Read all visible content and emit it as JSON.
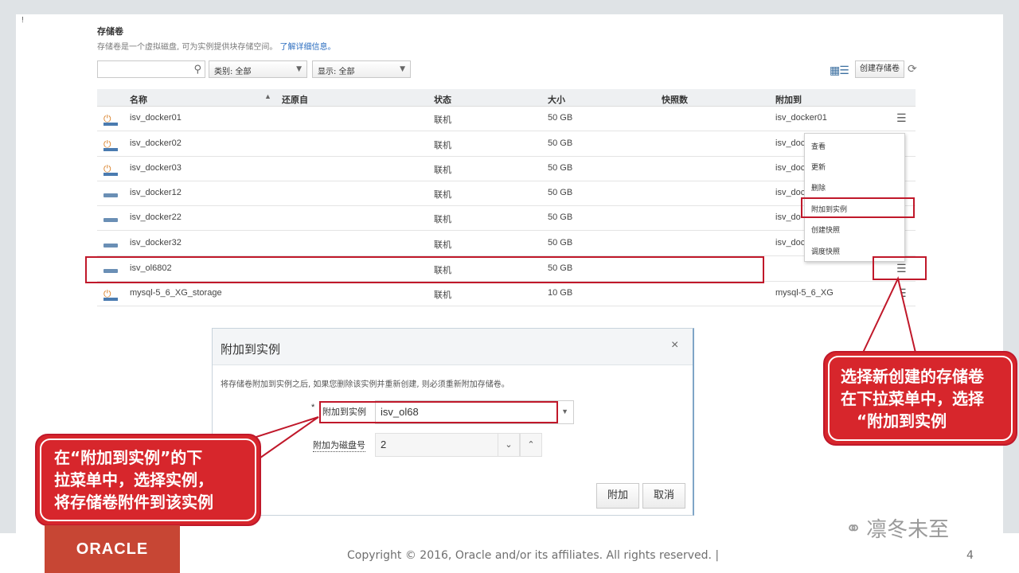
{
  "header": {
    "title": "存储卷",
    "description": "存储卷是一个虚拟磁盘, 可为实例提供块存储空间。",
    "learn_more": "了解详细信息。"
  },
  "toolbar": {
    "search_placeholder": "",
    "category_filter": "类别: 全部",
    "display_filter": "显示: 全部",
    "create_button": "创建存储卷"
  },
  "table": {
    "columns": [
      "名称",
      "还原自",
      "状态",
      "大小",
      "快照数",
      "附加到"
    ],
    "rows": [
      {
        "icon": "power",
        "name": "isv_docker01",
        "restore": "",
        "status": "联机",
        "size": "50 GB",
        "snapshots": "",
        "attached": "isv_docker01"
      },
      {
        "icon": "power",
        "name": "isv_docker02",
        "restore": "",
        "status": "联机",
        "size": "50 GB",
        "snapshots": "",
        "attached": "isv_doc"
      },
      {
        "icon": "power",
        "name": "isv_docker03",
        "restore": "",
        "status": "联机",
        "size": "50 GB",
        "snapshots": "",
        "attached": "isv_doc"
      },
      {
        "icon": "disk",
        "name": "isv_docker12",
        "restore": "",
        "status": "联机",
        "size": "50 GB",
        "snapshots": "",
        "attached": "isv_doc"
      },
      {
        "icon": "disk",
        "name": "isv_docker22",
        "restore": "",
        "status": "联机",
        "size": "50 GB",
        "snapshots": "",
        "attached": "isv_do"
      },
      {
        "icon": "disk",
        "name": "isv_docker32",
        "restore": "",
        "status": "联机",
        "size": "50 GB",
        "snapshots": "",
        "attached": "isv_doc"
      },
      {
        "icon": "disk",
        "name": "isv_ol6802",
        "restore": "",
        "status": "联机",
        "size": "50 GB",
        "snapshots": "",
        "attached": ""
      },
      {
        "icon": "power",
        "name": "mysql-5_6_XG_storage",
        "restore": "",
        "status": "联机",
        "size": "10 GB",
        "snapshots": "",
        "attached": "mysql-5_6_XG"
      }
    ]
  },
  "context_menu": {
    "items": [
      "查看",
      "更新",
      "删除",
      "附加到实例",
      "创建快照",
      "调度快照"
    ]
  },
  "dialog": {
    "title": "附加到实例",
    "close": "×",
    "note": "将存储卷附加到实例之后, 如果您删除该实例并重新创建, 则必须重新附加存储卷。",
    "required_mark": "*",
    "instance_label": "附加到实例",
    "instance_value": "isv_ol68",
    "disk_label": "附加为磁盘号",
    "disk_value": "2",
    "attach_button": "附加",
    "cancel_button": "取消"
  },
  "callouts": {
    "left_lines": [
      "在“附加到实例”的下",
      "拉菜单中，选择实例，",
      "将存储卷附件到该实例"
    ],
    "right_lines": [
      "选择新创建的存储卷",
      "在下拉菜单中，选择",
      "“附加到实例"
    ]
  },
  "footer": {
    "logo": "ORACLE",
    "copyright": "Copyright © 2016, Oracle and/or its affiliates. All rights reserved.  |",
    "page": "4",
    "watermark": "凛冬未至"
  },
  "colors": {
    "accent_red": "#c0182a",
    "oracle_red": "#c74634",
    "link_blue": "#2a6cbf"
  }
}
